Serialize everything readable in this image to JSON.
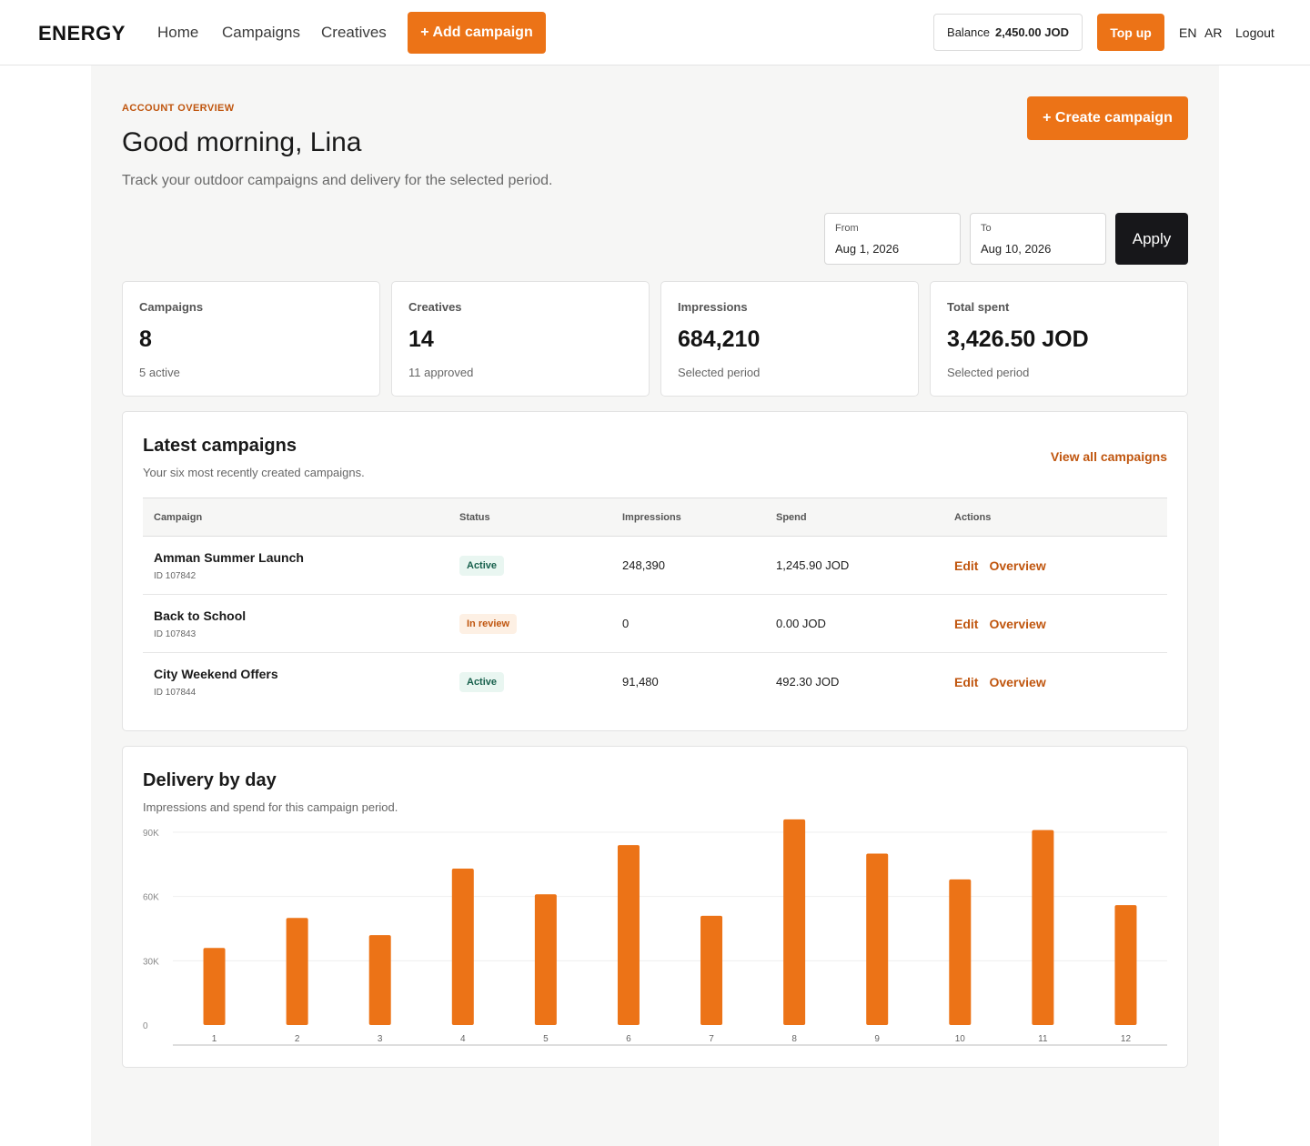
{
  "header": {
    "logo": "ENERGY",
    "nav": [
      "Home",
      "Campaigns",
      "Creatives"
    ],
    "add_campaign": "+ Add campaign",
    "balance_label": "Balance",
    "balance_value": "2,450.00 JOD",
    "topup": "Top up",
    "languages": [
      "EN",
      "AR"
    ],
    "logout": "Logout"
  },
  "overview": {
    "eyebrow": "ACCOUNT OVERVIEW",
    "greeting": "Good morning, Lina",
    "subtitle": "Track your outdoor campaigns and delivery for the selected period.",
    "create_campaign": "+ Create campaign"
  },
  "date_filter": {
    "from_label": "From",
    "from_value": "Aug 1, 2026",
    "to_label": "To",
    "to_value": "Aug 10, 2026",
    "apply": "Apply"
  },
  "stats": [
    {
      "label": "Campaigns",
      "value": "8",
      "sub": "5 active"
    },
    {
      "label": "Creatives",
      "value": "14",
      "sub": "11 approved"
    },
    {
      "label": "Impressions",
      "value": "684,210",
      "sub": "Selected period"
    },
    {
      "label": "Total spent",
      "value": "3,426.50 JOD",
      "sub": "Selected period"
    }
  ],
  "latest": {
    "title": "Latest campaigns",
    "subtitle": "Your six most recently created campaigns.",
    "view_all": "View all campaigns",
    "columns": [
      "Campaign",
      "Status",
      "Impressions",
      "Spend",
      "Actions"
    ],
    "rows": [
      {
        "name": "Amman Summer Launch",
        "id": "ID 107842",
        "status": "Active",
        "status_kind": "active",
        "impressions": "248,390",
        "spend": "1,245.90 JOD"
      },
      {
        "name": "Back to School",
        "id": "ID 107843",
        "status": "In review",
        "status_kind": "review",
        "impressions": "0",
        "spend": "0.00 JOD"
      },
      {
        "name": "City Weekend Offers",
        "id": "ID 107844",
        "status": "Active",
        "status_kind": "active",
        "impressions": "91,480",
        "spend": "492.30 JOD"
      }
    ],
    "edit_label": "Edit",
    "overview_label": "Overview"
  },
  "delivery": {
    "title": "Delivery by day",
    "subtitle": "Impressions and spend for this campaign period."
  },
  "chart_data": {
    "type": "bar",
    "categories": [
      "1",
      "2",
      "3",
      "4",
      "5",
      "6",
      "7",
      "8",
      "9",
      "10",
      "11",
      "12"
    ],
    "values": [
      36000,
      50000,
      42000,
      73000,
      61000,
      84000,
      51000,
      96000,
      80000,
      68000,
      91000,
      56000
    ],
    "ylim": [
      0,
      90000
    ],
    "y_ticks": [
      0,
      30000,
      60000,
      90000
    ],
    "y_tick_labels": [
      "0",
      "30K",
      "60K",
      "90K"
    ],
    "title": "",
    "xlabel": "",
    "ylabel": "",
    "bar_color": "#ec7317",
    "grid": true
  },
  "colors": {
    "accent": "#ec7317",
    "accent_text": "#c0560f",
    "dark_button": "#17171a",
    "active_badge": "#17604c"
  }
}
